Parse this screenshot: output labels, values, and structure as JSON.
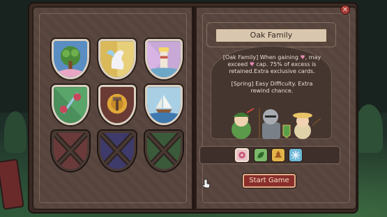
{
  "family": {
    "title": "Oak Family",
    "desc_prefix": "[Oak Family] When gaining",
    "desc_mid": "may exceed",
    "desc_suffix": "cap. 75% of excess is retained.Extra exclusive cards.",
    "spring_text": "[Spring] Easy Difficulty. Extra rewind chance."
  },
  "crests": [
    {
      "name": "oak-tree-crest",
      "locked": false
    },
    {
      "name": "pegasus-crest",
      "locked": false
    },
    {
      "name": "lighthouse-crest",
      "locked": false
    },
    {
      "name": "sword-rose-crest",
      "locked": false
    },
    {
      "name": "hammer-crest",
      "locked": false
    },
    {
      "name": "ship-crest",
      "locked": false
    },
    {
      "name": "locked-crest",
      "locked": true
    },
    {
      "name": "locked-crest",
      "locked": true
    },
    {
      "name": "locked-crest",
      "locked": true
    }
  ],
  "seasons": [
    {
      "name": "spring-flower-icon",
      "color": "#e9c3c6",
      "selected": true
    },
    {
      "name": "summer-leaf-icon",
      "color": "#7bb86a"
    },
    {
      "name": "autumn-leaf-icon",
      "color": "#e2b54a"
    },
    {
      "name": "winter-snowflake-icon",
      "color": "#6fb7d6"
    }
  ],
  "start_button": "Start Game",
  "colors": {
    "accent": "#8a2e2a",
    "heart": "#e889b2"
  }
}
